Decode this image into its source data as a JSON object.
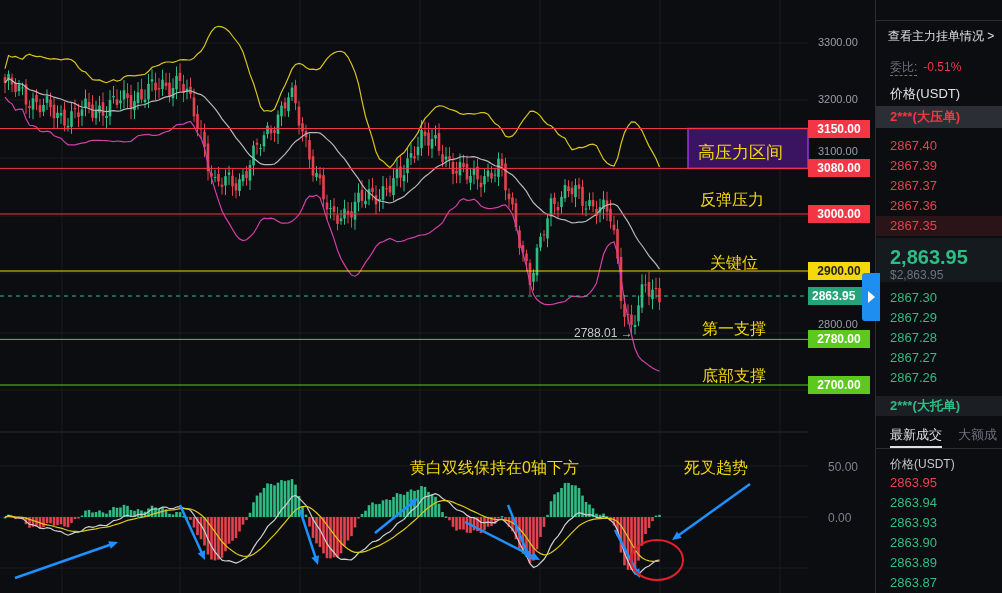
{
  "price_chart": {
    "axis_labels": [
      "3300.00",
      "3200.00",
      "3100.00",
      "2800.00"
    ],
    "levels": [
      {
        "label": "3150.00",
        "color": "#f23645"
      },
      {
        "label": "3080.00",
        "color": "#f23645"
      },
      {
        "label": "3000.00",
        "color": "#f23645"
      },
      {
        "label": "2900.00",
        "color": "#f5d90a"
      },
      {
        "label": "2780.00",
        "color": "#5cc91e"
      },
      {
        "label": "2700.00",
        "color": "#5cc91e"
      }
    ],
    "zone_label": "高压力区间",
    "annotations": [
      "反弹压力",
      "关键位",
      "第一支撑",
      "底部支撑"
    ],
    "current_price": "2863.95",
    "low_marker": "2788.01 →"
  },
  "macd_chart": {
    "axis_labels": [
      "50.00",
      "0.00"
    ],
    "annotations": [
      "黄白双线保持在0轴下方",
      "死叉趋势"
    ]
  },
  "order_book": {
    "link": "查看主力挂单情况 >",
    "ratio_label": "委比:",
    "ratio_value": "-0.51%",
    "price_header": "价格(USDT)",
    "big_ask": "2***(大压单)",
    "asks": [
      {
        "price": "2867.40",
        "selected": false
      },
      {
        "price": "2867.39",
        "selected": false
      },
      {
        "price": "2867.37",
        "selected": false
      },
      {
        "price": "2867.36",
        "selected": false
      },
      {
        "price": "2867.35",
        "selected": true
      }
    ],
    "last_price": "2,863.95",
    "last_price_usd": "$2,863.95",
    "bids": [
      "2867.30",
      "2867.29",
      "2867.28",
      "2867.27",
      "2867.26"
    ],
    "big_bid": "2***(大托单)",
    "tabs": [
      {
        "label": "最新成交",
        "selected": true
      },
      {
        "label": "大额成",
        "selected": false
      }
    ],
    "trades_header": "价格(USDT)",
    "trades": [
      {
        "price": "2863.95",
        "kind": "sell"
      },
      {
        "price": "2863.94",
        "kind": "buy"
      },
      {
        "price": "2863.93",
        "kind": "buy"
      },
      {
        "price": "2863.90",
        "kind": "buy"
      },
      {
        "price": "2863.89",
        "kind": "buy"
      },
      {
        "price": "2863.87",
        "kind": "buy"
      }
    ]
  }
}
